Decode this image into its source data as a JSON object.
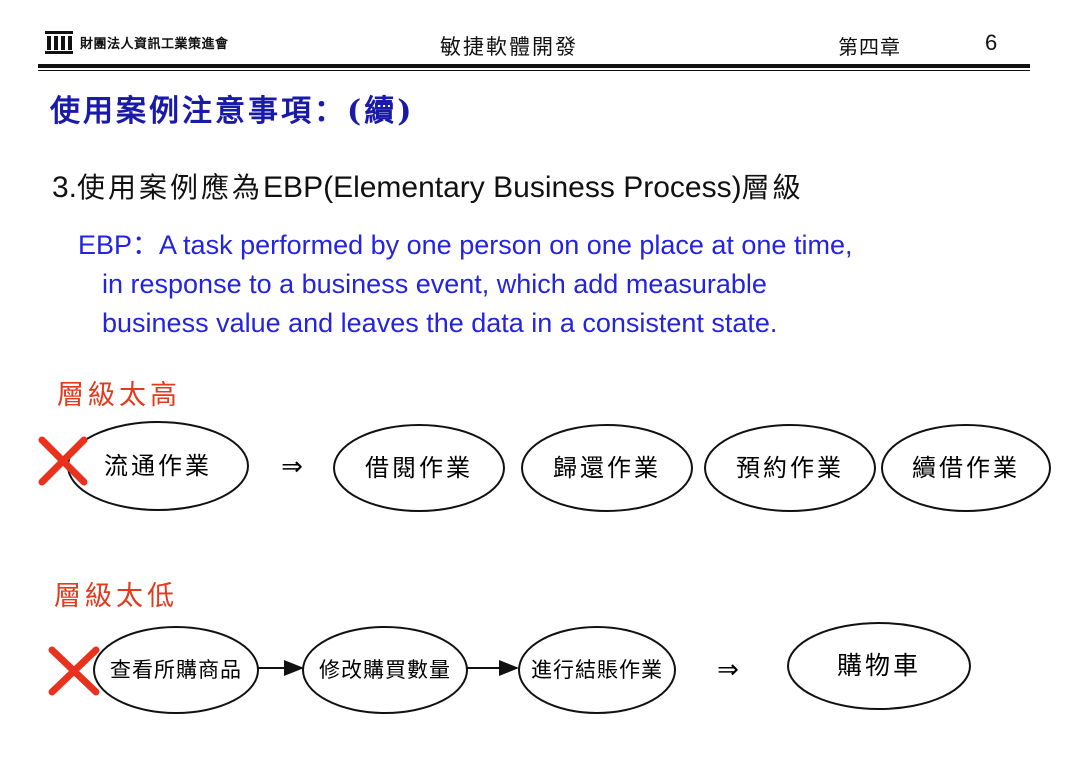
{
  "header": {
    "org_name": "財團法人資訊工業策進會",
    "course_title": "敏捷軟體開發",
    "chapter": "第四章",
    "page_number": "6"
  },
  "slide": {
    "title": "使用案例注意事項：(續)",
    "point": {
      "number": "3.",
      "prefix": "使用案例應為",
      "term": "EBP(Elementary Business Process)",
      "suffix": "層級"
    },
    "definition": {
      "line1": "EBP：A task performed by one person on one place at one time,",
      "line2": "in response to a business event, which add measurable",
      "line3": "business value and leaves the data in a consistent state."
    },
    "too_high": {
      "label": "層級太高",
      "source": "流通作業",
      "arrow": "⇒",
      "results": [
        "借閱作業",
        "歸還作業",
        "預約作業",
        "續借作業"
      ]
    },
    "too_low": {
      "label": "層級太低",
      "steps": [
        "查看所購商品",
        "修改購買數量",
        "進行結賬作業"
      ],
      "arrow": "⇒",
      "result": "購物車"
    }
  },
  "colors": {
    "title_blue": "#1a1aa8",
    "definition_blue": "#2323e0",
    "label_red": "#e4391c",
    "cross_red": "#e8321e"
  }
}
